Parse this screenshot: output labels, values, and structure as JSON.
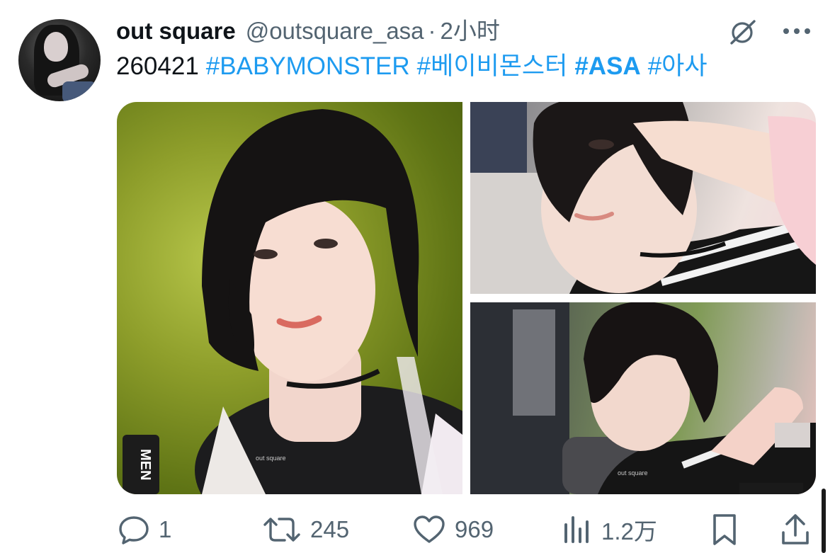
{
  "tweet": {
    "display_name": "out square",
    "handle": "@outsquare_asa",
    "separator": "·",
    "time": "2小时",
    "text_prefix": "260421",
    "hashtags": [
      "#BABYMONSTER",
      "#베이비몬스터",
      "#ASA",
      "#아사"
    ],
    "watermark": "out square"
  },
  "media": {
    "photo_1_label": "MEN"
  },
  "actions": {
    "reply": {
      "icon": "reply-icon",
      "count": "1"
    },
    "retweet": {
      "icon": "retweet-icon",
      "count": "245"
    },
    "like": {
      "icon": "heart-icon",
      "count": "969"
    },
    "views": {
      "icon": "views-icon",
      "count": "1.2万"
    },
    "bookmark": {
      "icon": "bookmark-icon"
    },
    "share": {
      "icon": "share-icon"
    }
  },
  "colors": {
    "text": "#0f1419",
    "secondary": "#536471",
    "link": "#1d9bf0"
  }
}
